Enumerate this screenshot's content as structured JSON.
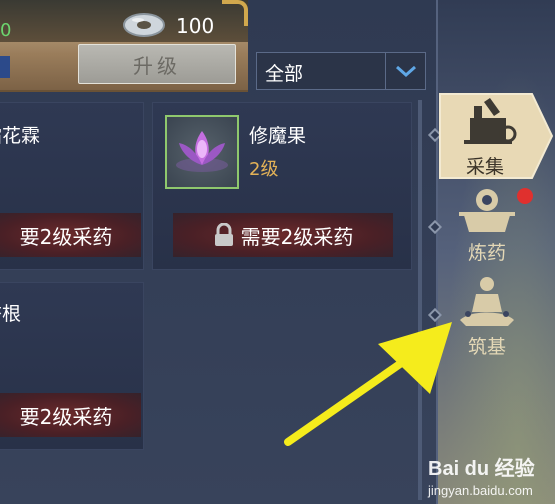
{
  "header": {
    "partial_value": "0",
    "currency_count": "100",
    "upgrade_label": "升级"
  },
  "filter": {
    "selected": "全部"
  },
  "cards": [
    {
      "name": "霜花霖",
      "requirement": "要2级采药",
      "locked": false
    },
    {
      "name": "修魔果",
      "level": "2级",
      "requirement": "需要2级采药",
      "locked": true
    },
    {
      "name": "杏根",
      "requirement": "要2级采药",
      "locked": false
    }
  ],
  "nav": {
    "items": [
      {
        "label": "采集",
        "active": true
      },
      {
        "label": "炼药",
        "active": false,
        "badge": true
      },
      {
        "label": "筑基",
        "active": false
      }
    ]
  },
  "watermark": {
    "top": "Bai du 经验",
    "bottom": "jingyan.baidu.com"
  },
  "colors": {
    "level_gold": "#e3b257",
    "active_tab": "#e8d9b5",
    "arrow_yellow": "#f5ec1c",
    "badge_red": "#e0302e"
  }
}
